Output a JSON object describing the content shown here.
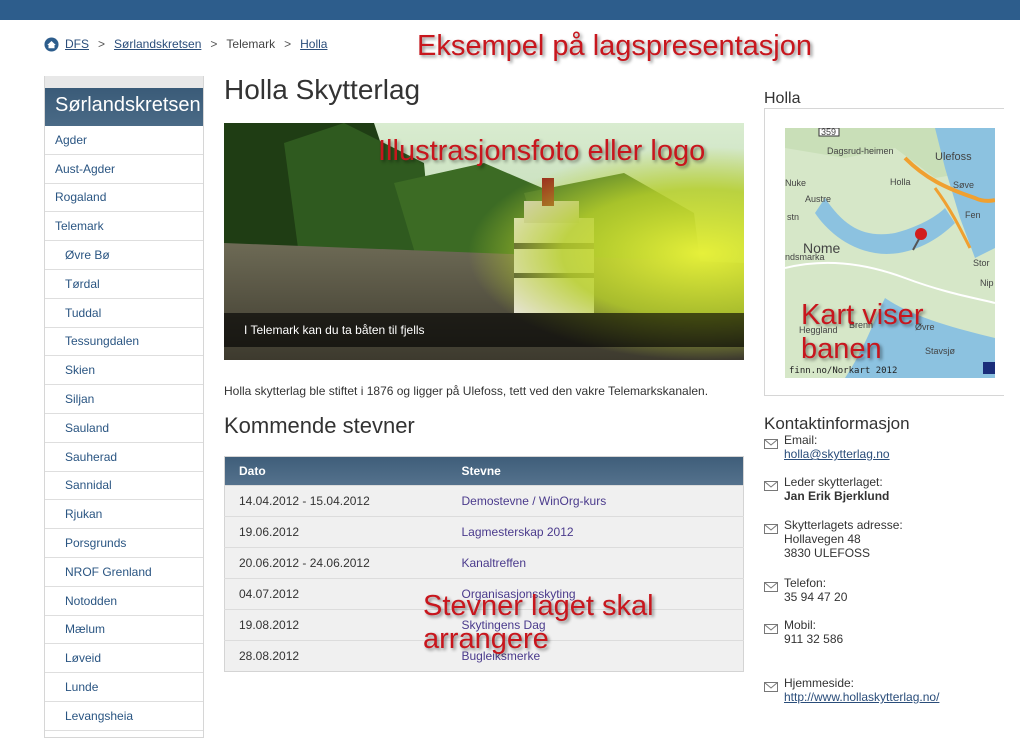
{
  "breadcrumb": {
    "items": [
      "DFS",
      "Sørlandskretsen",
      "Telemark",
      "Holla"
    ],
    "separator": ">"
  },
  "annotations": {
    "top": "Eksempel på lagspresentasjon",
    "photo": "Illustrasjonsfoto eller logo",
    "map": "Kart viser banen",
    "events": "Stevner laget skal arrangere"
  },
  "sidebar": {
    "title": "Sørlandskretsen",
    "items": [
      {
        "label": "Agder",
        "level": 1
      },
      {
        "label": "Aust-Agder",
        "level": 1
      },
      {
        "label": "Rogaland",
        "level": 1
      },
      {
        "label": "Telemark",
        "level": 1
      },
      {
        "label": "Øvre Bø",
        "level": 2
      },
      {
        "label": "Tørdal",
        "level": 2
      },
      {
        "label": "Tuddal",
        "level": 2
      },
      {
        "label": "Tessungdalen",
        "level": 2
      },
      {
        "label": "Skien",
        "level": 2
      },
      {
        "label": "Siljan",
        "level": 2
      },
      {
        "label": "Sauland",
        "level": 2
      },
      {
        "label": "Sauherad",
        "level": 2
      },
      {
        "label": "Sannidal",
        "level": 2
      },
      {
        "label": "Rjukan",
        "level": 2
      },
      {
        "label": "Porsgrunds",
        "level": 2
      },
      {
        "label": "NROF Grenland",
        "level": 2
      },
      {
        "label": "Notodden",
        "level": 2
      },
      {
        "label": "Mælum",
        "level": 2
      },
      {
        "label": "Løveid",
        "level": 2
      },
      {
        "label": "Lunde",
        "level": 2
      },
      {
        "label": "Levangsheia",
        "level": 2
      }
    ]
  },
  "main": {
    "title": "Holla Skytterlag",
    "hero_caption": "I Telemark kan du ta båten til fjells",
    "intro": "Holla skytterlag ble stiftet i 1876 og ligger på Ulefoss, tett ved den vakre Telemarkskanalen.",
    "events_title": "Kommende stevner",
    "events_headers": [
      "Dato",
      "Stevne"
    ],
    "events": [
      {
        "date": "14.04.2012 - 15.04.2012",
        "name": "Demostevne / WinOrg-kurs"
      },
      {
        "date": "19.06.2012",
        "name": "Lagmesterskap 2012"
      },
      {
        "date": "20.06.2012 - 24.06.2012",
        "name": "Kanaltreffen"
      },
      {
        "date": "04.07.2012",
        "name": "Organisasjonsskyting"
      },
      {
        "date": "19.08.2012",
        "name": "Skytingens Dag"
      },
      {
        "date": "28.08.2012",
        "name": "Bugleiksmerke"
      }
    ]
  },
  "map": {
    "title": "Holla",
    "credit": "finn.no/Norkart 2012",
    "labels": [
      "359",
      "Dagsrud-heimen",
      "Ulefoss",
      "Nuke",
      "Austre",
      "Holla",
      "Søve",
      "Fen",
      "Nome",
      "ndsmarka",
      "Stor",
      "Nip",
      "Heggland",
      "Brenn",
      "Øvre",
      "Stavsjø",
      "stn"
    ]
  },
  "contact": {
    "title": "Kontaktinformasjon",
    "email_label": "Email:",
    "email": "holla@skytterlag.no",
    "leader_label": "Leder skytterlaget:",
    "leader": "Jan Erik Bjerklund",
    "address_label": "Skytterlagets adresse:",
    "address_line1": "Hollavegen 48",
    "address_line2": "3830 ULEFOSS",
    "phone_label": "Telefon:",
    "phone": "35 94 47 20",
    "mobile_label": "Mobil:",
    "mobile": "911 32 586",
    "homepage_label": "Hjemmeside:",
    "homepage": "http://www.hollaskytterlag.no/"
  },
  "colors": {
    "topbar": "#2d5d8c",
    "accent_red": "#c8161d",
    "link": "#2a4d7a",
    "header_gradient": "#3f5e7a"
  },
  "icons": [
    "home-icon",
    "mail-icon",
    "map-pin-icon"
  ]
}
